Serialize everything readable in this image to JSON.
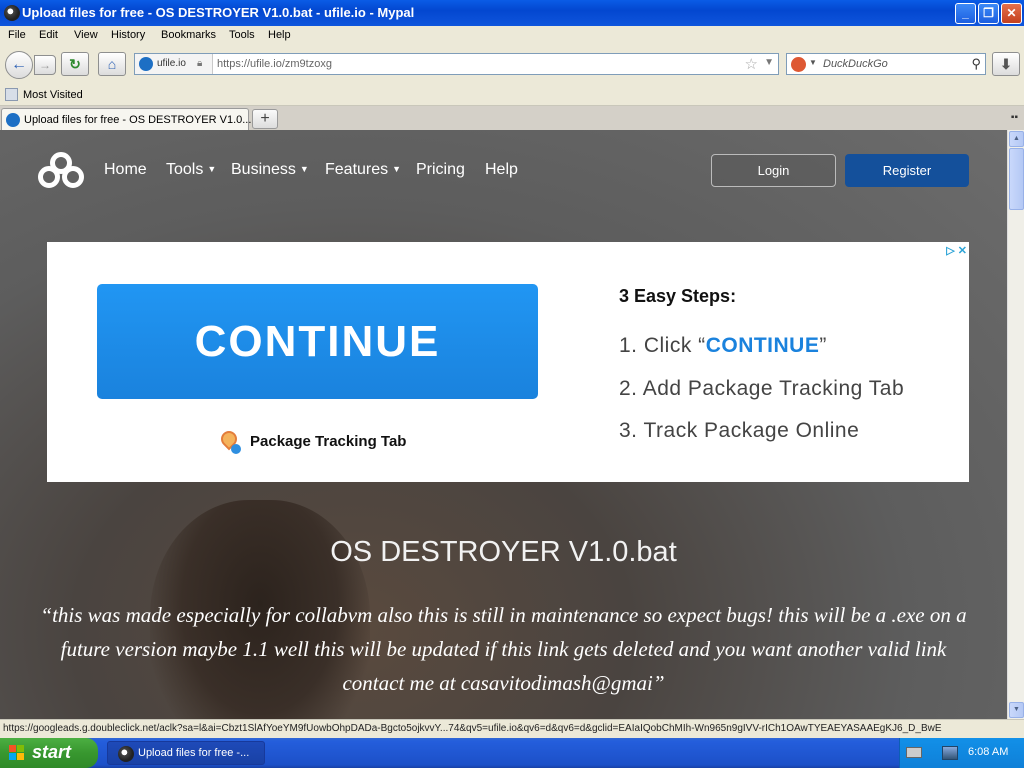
{
  "window": {
    "title": "Upload files for free - OS DESTROYER V1.0.bat - ufile.io - Mypal"
  },
  "menu": {
    "items": [
      "File",
      "Edit",
      "View",
      "History",
      "Bookmarks",
      "Tools",
      "Help"
    ]
  },
  "navbar": {
    "site_identity": "ufile.io",
    "url": "https://ufile.io/zm9tzoxg",
    "search_placeholder": "DuckDuckGo"
  },
  "bookmarks": {
    "items": [
      "Most Visited"
    ]
  },
  "tabs": {
    "items": [
      {
        "label": "Upload files for free - OS DESTROYER V1.0...."
      }
    ],
    "new_tab": "+"
  },
  "site": {
    "nav": [
      "Home",
      "Tools",
      "Business",
      "Features",
      "Pricing",
      "Help"
    ],
    "login_label": "Login",
    "register_label": "Register"
  },
  "ad": {
    "button_label": "CONTINUE",
    "package_label": "Package Tracking Tab",
    "steps_title": "3 Easy Steps:",
    "step1_prefix": "1. Click “",
    "step1_highlight": "CONTINUE",
    "step1_suffix": "”",
    "step2": "2. Add Package Tracking Tab",
    "step3": "3. Track Package Online",
    "brand_color": "#1a82dd"
  },
  "page": {
    "file_title": "OS DESTROYER V1.0.bat",
    "description": "“this was made especially for collabvm also this is still in maintenance so expect bugs! this will be a .exe on a future version maybe 1.1 well this will be updated if this link gets deleted and you want another valid link contact me at casavitodimash@gmai”"
  },
  "statusbar": {
    "text": "https://googleads.g.doubleclick.net/aclk?sa=l&ai=Cbzt1SlAfYoeYM9fUowbOhpDADa-Bgcto5ojkvvY...74&qv5=ufile.io&qv6=d&qv6=d&gclid=EAIaIQobChMIh-Wn965n9gIVV-rICh1OAwTYEAEYASAAEgKJ6_D_BwE"
  },
  "taskbar": {
    "start_label": "start",
    "task_label": "Upload files for free -...",
    "clock": "6:08 AM"
  }
}
